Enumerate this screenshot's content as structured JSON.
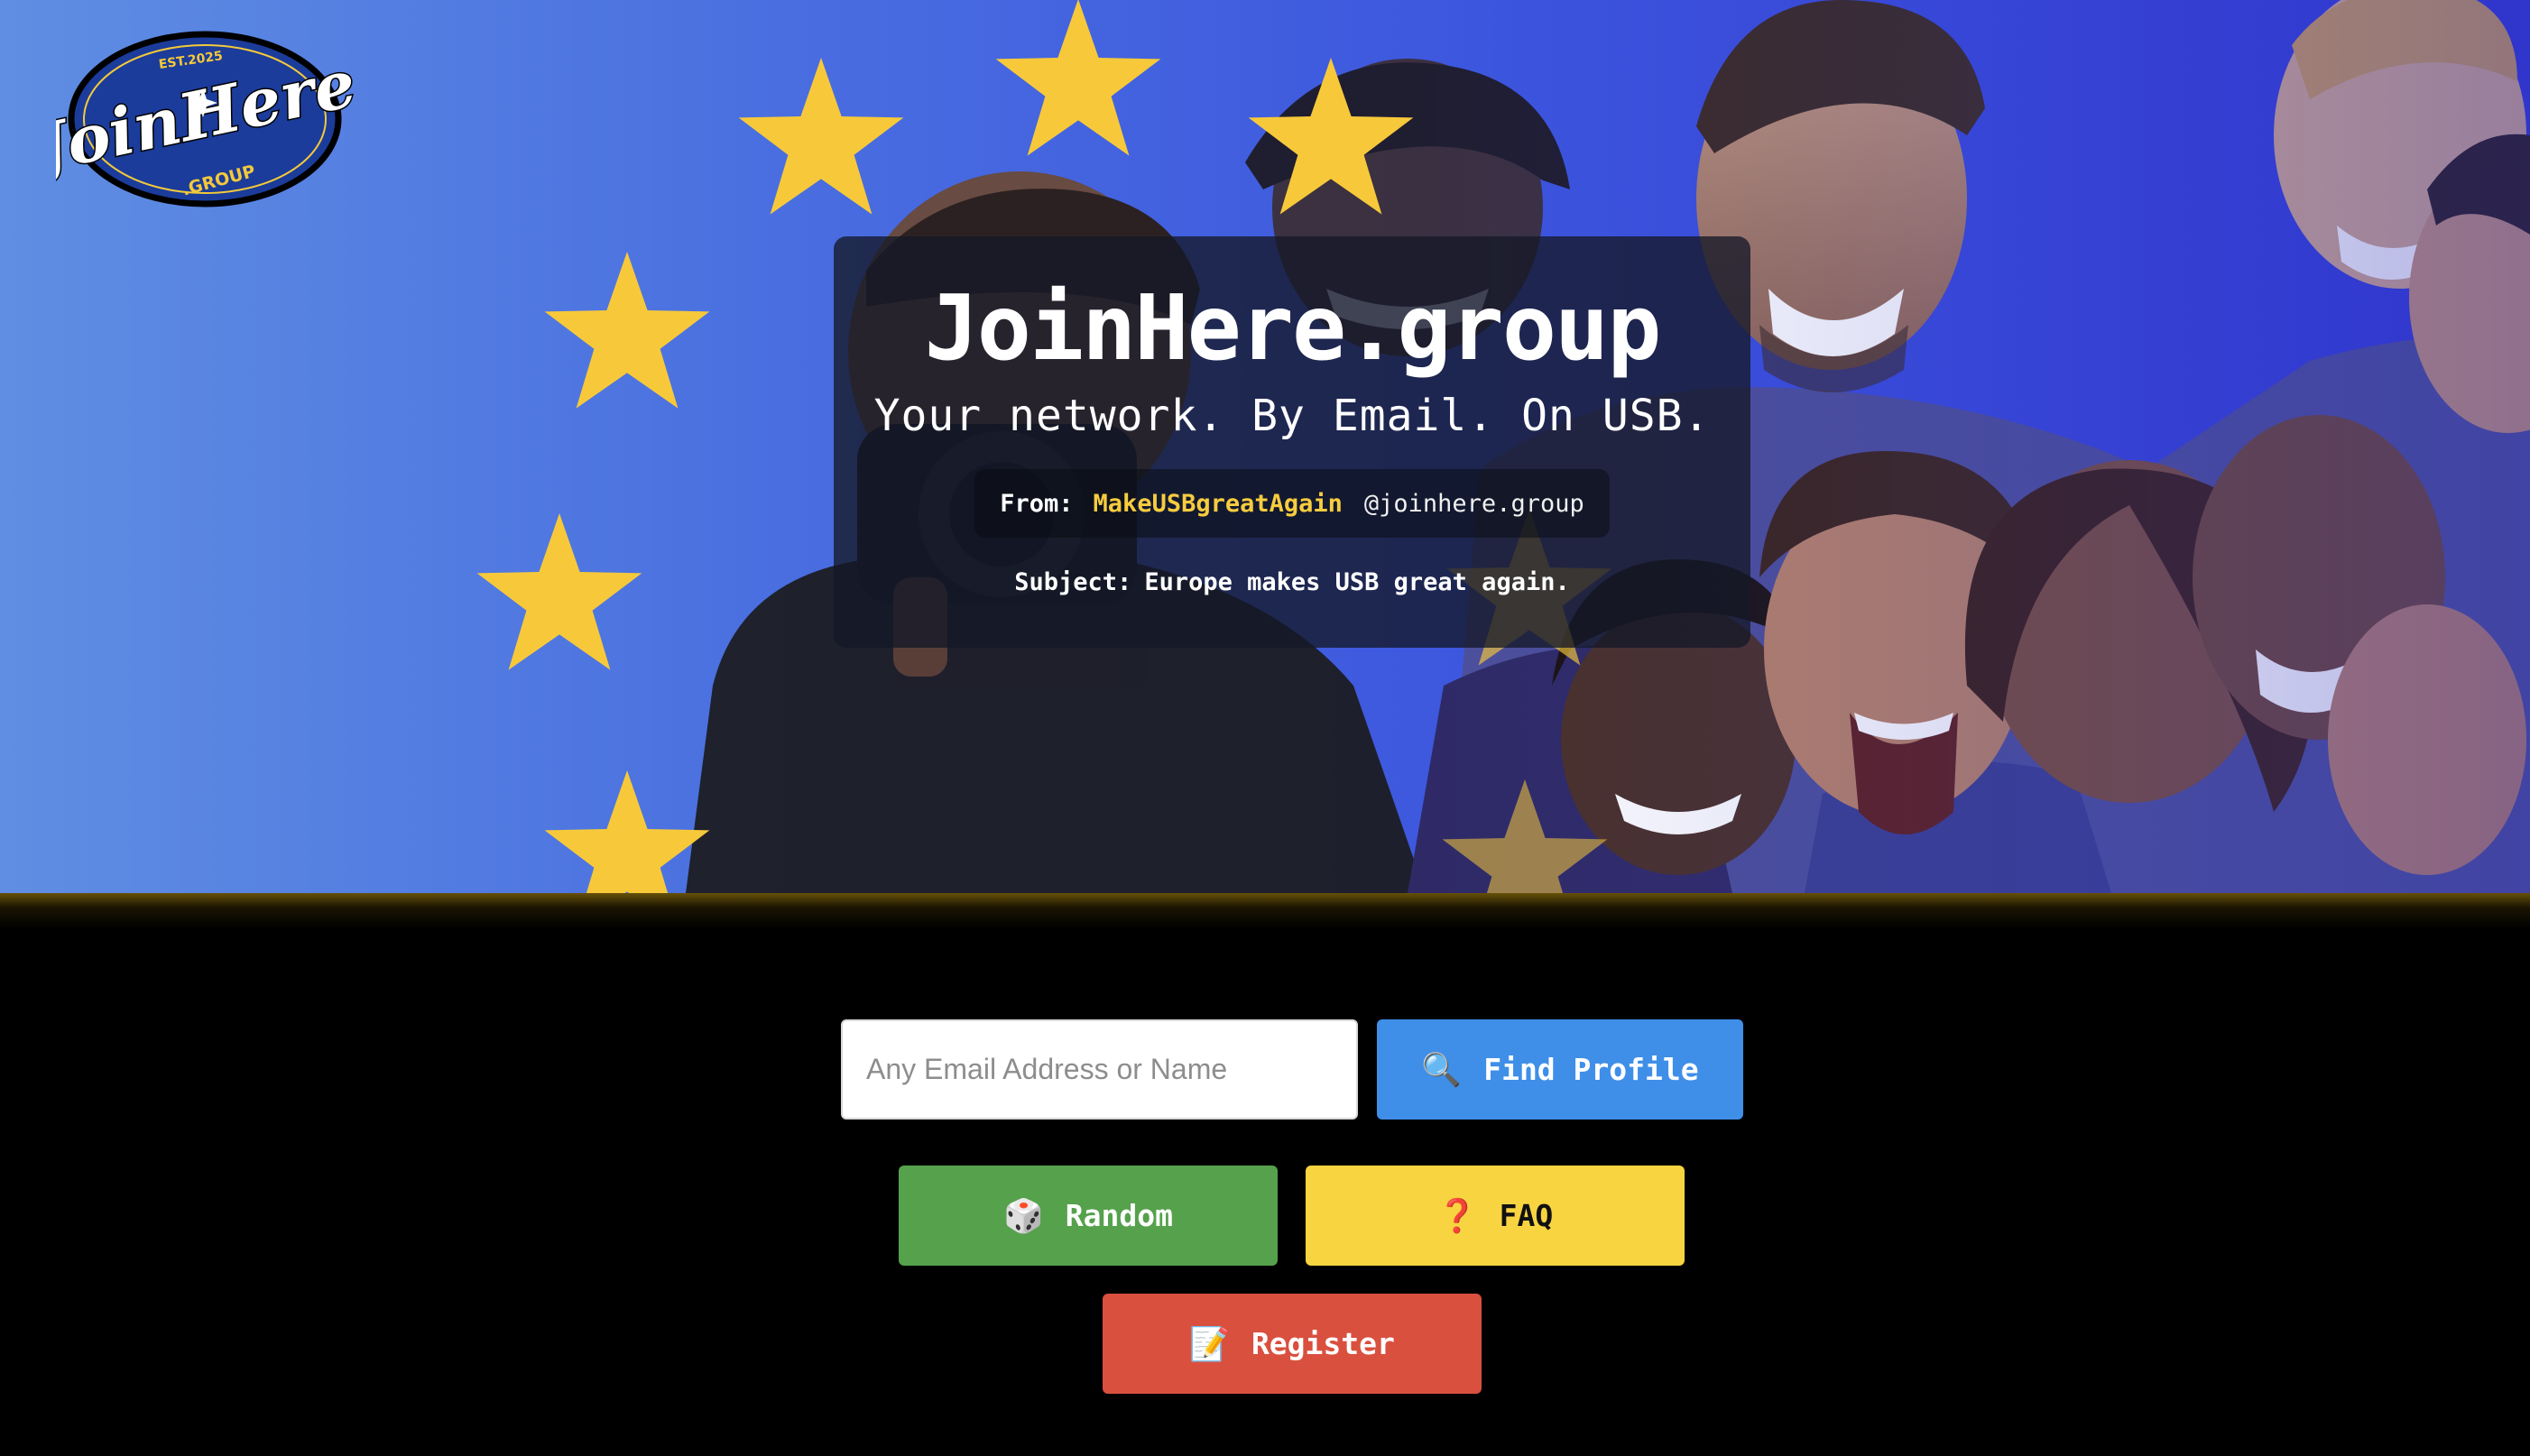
{
  "logo": {
    "est": "EST.2025",
    "script": "JoinHere",
    "group": ".GROUP"
  },
  "hero": {
    "title": "JoinHere.group",
    "tagline": "Your network. By Email. On USB.",
    "from_label": "From:",
    "from_user": "MakeUSBgreatAgain",
    "from_domain": "@joinhere.group",
    "subject_label": "Subject:",
    "subject_text": "Europe makes USB great again."
  },
  "search": {
    "placeholder": "Any Email Address or Name",
    "value": ""
  },
  "buttons": {
    "find_icon": "🔍",
    "find_label": "Find Profile",
    "random_icon": "🎲",
    "random_label": "Random",
    "faq_icon": "❓",
    "faq_label": "FAQ",
    "register_icon": "📝",
    "register_label": "Register"
  },
  "colors": {
    "hero_blue": "#3c55de",
    "star_yellow": "#f7c93a",
    "find": "#3f8fe8",
    "random": "#56a14c",
    "faq": "#f8d441",
    "register": "#d9503f",
    "from_user": "#f7cc3e"
  }
}
